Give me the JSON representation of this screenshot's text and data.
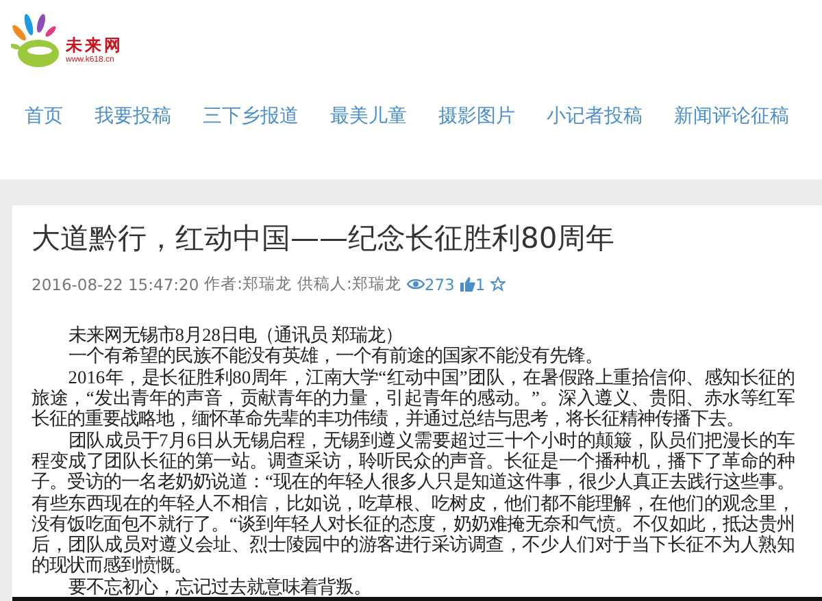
{
  "logo": {
    "name": "未来网",
    "url": "www.k618.cn"
  },
  "nav": [
    {
      "label": "首页"
    },
    {
      "label": "我要投稿"
    },
    {
      "label": "三下乡报道"
    },
    {
      "label": "最美儿童"
    },
    {
      "label": "摄影图片"
    },
    {
      "label": "小记者投稿"
    },
    {
      "label": "新闻评论征稿"
    }
  ],
  "article": {
    "title": "大道黔行，红动中国——纪念长征胜利80周年",
    "meta": {
      "datetime": "2016-08-22 15:47:20",
      "author": "作者:郑瑞龙",
      "contributor": "供稿人:郑瑞龙",
      "views": "273",
      "likes": "1"
    },
    "paragraphs": [
      "未来网无锡市8月28日电（通讯员 郑瑞龙）",
      "一个有希望的民族不能没有英雄，一个有前途的国家不能没有先锋。",
      "2016年，是长征胜利80周年，江南大学“红动中国”团队，在暑假路上重拾信仰、感知长征的旅途，“发出青年的声音，贡献青年的力量，引起青年的感动。”。深入遵义、贵阳、赤水等红军长征的重要战略地，缅怀革命先辈的丰功伟绩，并通过总结与思考，将长征精神传播下去。",
      "团队成员于7月6日从无锡启程，无锡到遵义需要超过三十个小时的颠簸，队员们把漫长的车程变成了团队长征的第一站。调查采访，聆听民众的声音。长征是一个播种机，播下了革命的种子。受访的一名老奶奶说道：“现在的年轻人很多人只是知道这件事，很少人真正去践行这些事。有些东西现在的年轻人不相信，比如说，吃草根、吃树皮，他们都不能理解，在他们的观念里，没有饭吃面包不就行了。“谈到年轻人对长征的态度，奶奶难掩无奈和气愤。不仅如此，抵达贵州后，团队成员对遵义会址、烈士陵园中的游客进行采访调查，不少人们对于当下长征不为人熟知的现状而感到愤慨。",
      "要不忘初心，忘记过去就意味着背叛。"
    ]
  }
}
